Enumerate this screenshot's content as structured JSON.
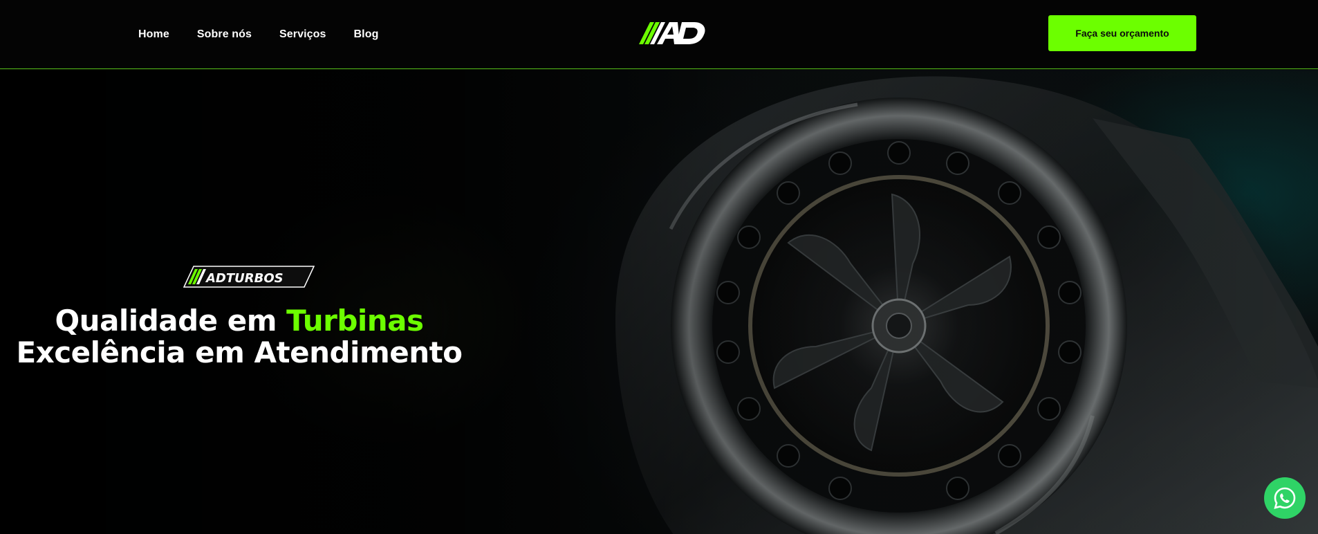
{
  "nav": {
    "items": [
      {
        "label": "Home"
      },
      {
        "label": "Sobre nós"
      },
      {
        "label": "Serviços"
      },
      {
        "label": "Blog"
      }
    ]
  },
  "logo": {
    "text": "AD",
    "icon": "ad-logo-icon"
  },
  "cta": {
    "label": "Faça seu orçamento"
  },
  "hero": {
    "badge_text": "ADTURBOS",
    "headline_part1": "Qualidade em ",
    "headline_accent": "Turbinas",
    "headline_line2": "Excelência em Atendimento"
  },
  "whatsapp": {
    "icon": "whatsapp-icon"
  },
  "colors": {
    "accent": "#6cff00",
    "header_bg": "#040404",
    "whatsapp": "#2fd366"
  }
}
